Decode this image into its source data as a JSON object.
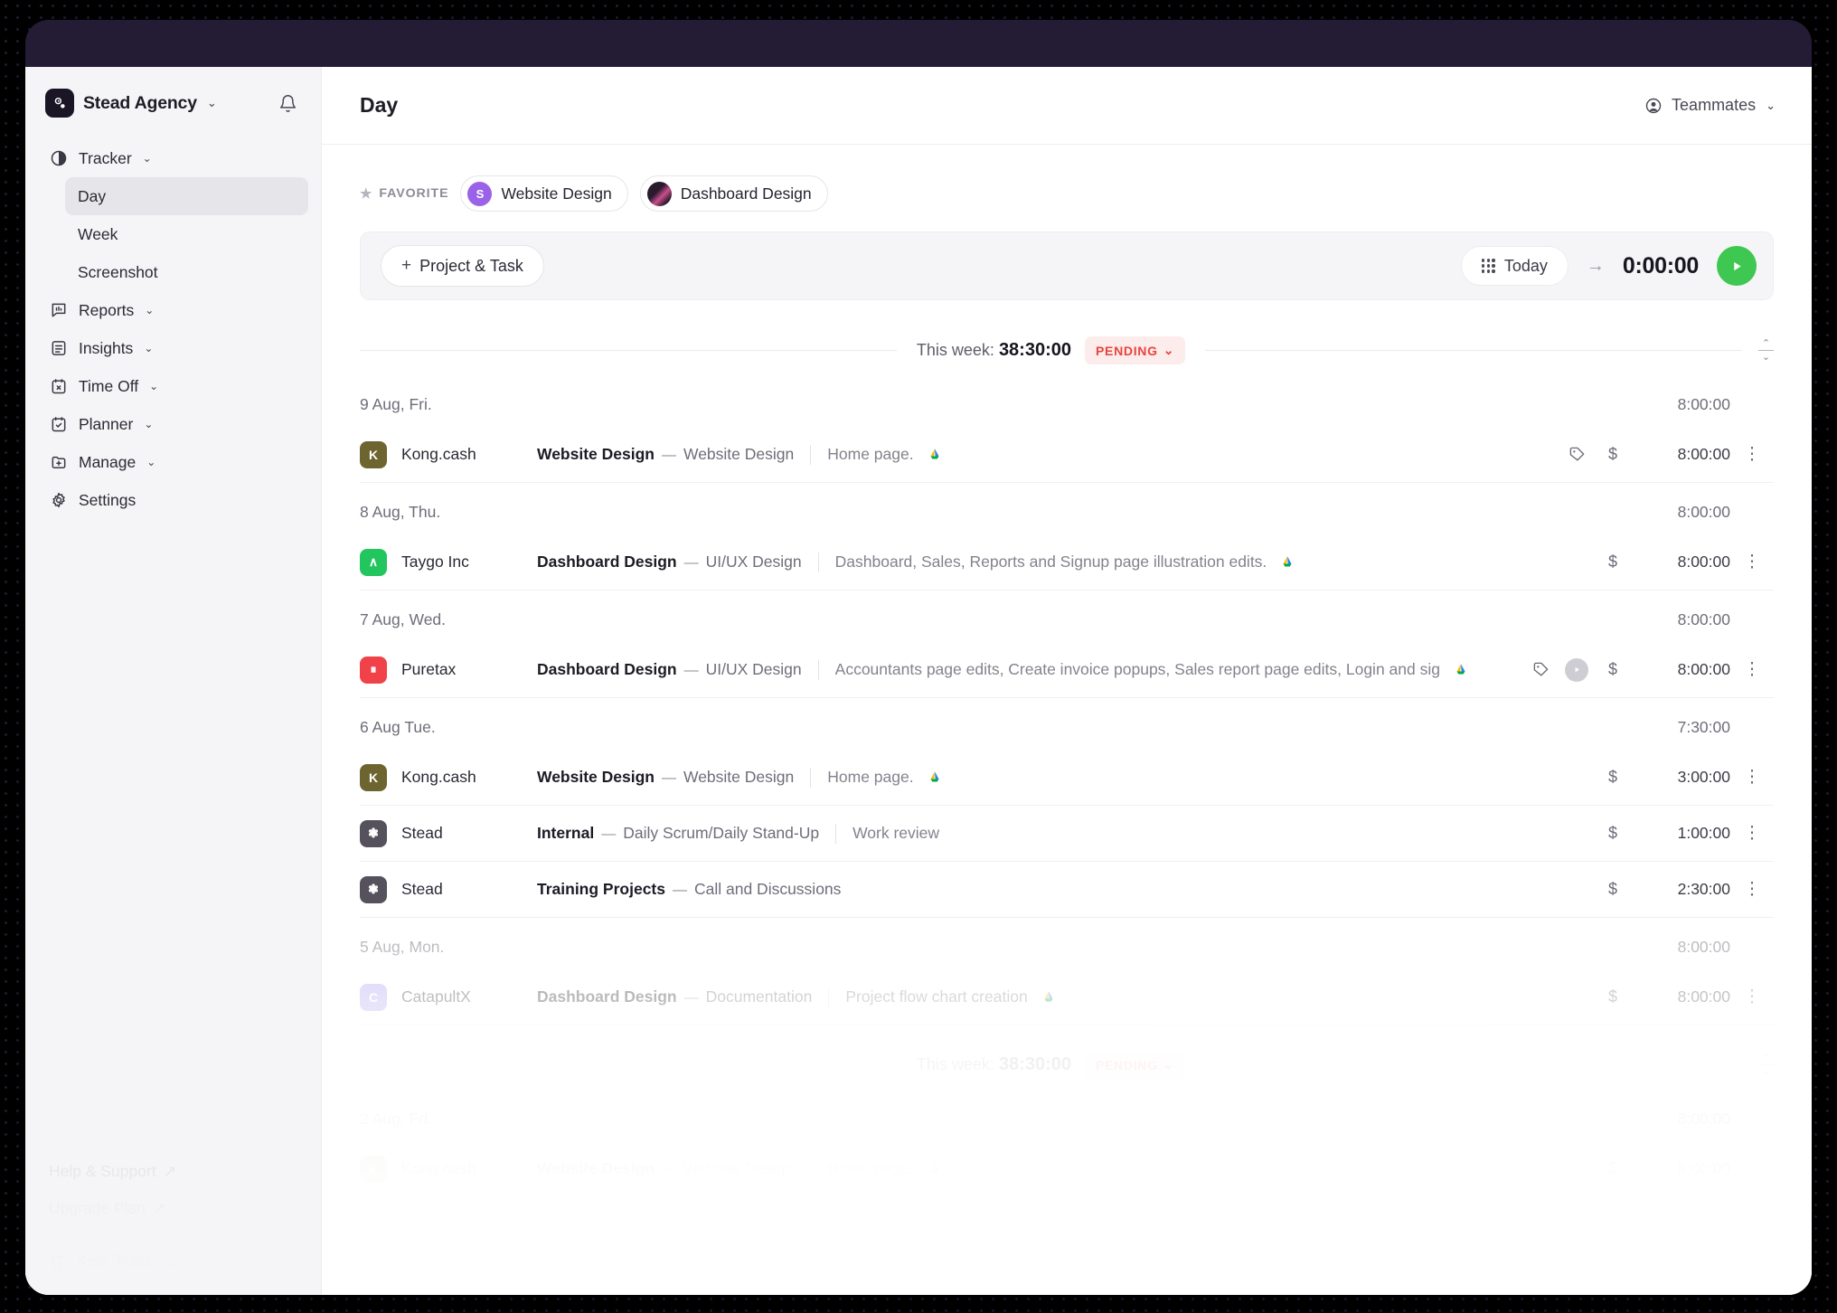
{
  "window": {
    "title_bar_color": "#241c35"
  },
  "sidebar": {
    "brand": {
      "name": "Stead Agency",
      "caret": "⌄",
      "logo_glyph": "❃"
    },
    "bell_icon": "bell-icon",
    "nav": [
      {
        "id": "tracker",
        "label": "Tracker",
        "icon": "clock-icon",
        "caret": "⌄",
        "children": [
          {
            "id": "day",
            "label": "Day",
            "active": true
          },
          {
            "id": "week",
            "label": "Week",
            "active": false
          },
          {
            "id": "screenshot",
            "label": "Screenshot",
            "active": false
          }
        ]
      },
      {
        "id": "reports",
        "label": "Reports",
        "icon": "chart-icon",
        "caret": "⌄"
      },
      {
        "id": "insights",
        "label": "Insights",
        "icon": "list-icon",
        "caret": "⌄"
      },
      {
        "id": "timeoff",
        "label": "Time Off",
        "icon": "calendar-x-icon",
        "caret": "⌄"
      },
      {
        "id": "planner",
        "label": "Planner",
        "icon": "calendar-check-icon",
        "caret": "⌄"
      },
      {
        "id": "manage",
        "label": "Manage",
        "icon": "folder-plus-icon",
        "caret": "⌄"
      },
      {
        "id": "settings",
        "label": "Settings",
        "icon": "gear-icon",
        "caret": ""
      }
    ],
    "footer": {
      "help": "Help & Support",
      "help_arrow": "↗",
      "upgrade": "Upgrade Plan",
      "upgrade_arrow": "↗",
      "product": "Kipe Track",
      "product_caret": "⌄"
    }
  },
  "header": {
    "page_title": "Day",
    "teammates_label": "Teammates",
    "teammates_caret": "⌄",
    "teammates_icon": "user-circle-icon"
  },
  "favorites": {
    "label": "FAVORITE",
    "star": "★",
    "chips": [
      {
        "label": "Website Design",
        "initial": "S",
        "color": "#9a62e8"
      },
      {
        "label": "Dashboard Design",
        "initial": "",
        "color": "#1b1320"
      }
    ]
  },
  "timer": {
    "add_label": "Project & Task",
    "add_plus": "+",
    "today_label": "Today",
    "arrow": "→",
    "elapsed": "0:00:00",
    "play_icon": "play-icon"
  },
  "week_summary": {
    "label": "This week:",
    "total": "38:30:00",
    "status": "PENDING",
    "status_caret": "⌄",
    "status_color": "#e8443d",
    "sort_icon": "sort-icon"
  },
  "groups": [
    {
      "date": "9 Aug, Fri.",
      "total": "8:00:00",
      "opacity": "full",
      "entries": [
        {
          "avatar_initial": "K",
          "avatar_color": "#6e6430",
          "client": "Kong.cash",
          "project": "Website Design",
          "dash": "—",
          "task": "Website Design",
          "description": "Home page.",
          "drive": true,
          "tag_icon": true,
          "grey_play": false,
          "dollar": "$",
          "time": "8:00:00",
          "kebab": "⋮"
        }
      ]
    },
    {
      "date": "8 Aug, Thu.",
      "total": "8:00:00",
      "opacity": "full",
      "entries": [
        {
          "avatar_initial": "∧",
          "avatar_color": "#22c55e",
          "client": "Taygo Inc",
          "project": "Dashboard Design",
          "dash": "—",
          "task": "UI/UX Design",
          "description": "Dashboard, Sales, Reports and Signup page illustration edits.",
          "drive": true,
          "tag_icon": false,
          "grey_play": false,
          "dollar": "$",
          "time": "8:00:00",
          "kebab": "⋮"
        }
      ]
    },
    {
      "date": "7 Aug, Wed.",
      "total": "8:00:00",
      "opacity": "full",
      "entries": [
        {
          "avatar_initial": "⏸",
          "avatar_color": "#f04248",
          "client": "Puretax",
          "project": "Dashboard Design",
          "dash": "—",
          "task": "UI/UX Design",
          "description": "Accountants page edits, Create invoice popups, Sales report page edits, Login and sig",
          "drive": true,
          "tag_icon": true,
          "grey_play": true,
          "dollar": "$",
          "time": "8:00:00",
          "kebab": "⋮"
        }
      ]
    },
    {
      "date": "6 Aug Tue.",
      "total": "7:30:00",
      "opacity": "full",
      "entries": [
        {
          "avatar_initial": "K",
          "avatar_color": "#6e6430",
          "client": "Kong.cash",
          "project": "Website Design",
          "dash": "—",
          "task": "Website Design",
          "description": "Home page.",
          "drive": true,
          "tag_icon": false,
          "grey_play": false,
          "dollar": "$",
          "time": "3:00:00",
          "kebab": "⋮"
        },
        {
          "avatar_initial": "❃",
          "avatar_color": "#55525e",
          "client": "Stead",
          "project": "Internal",
          "dash": "—",
          "task": "Daily Scrum/Daily Stand-Up",
          "description": "Work review",
          "drive": false,
          "tag_icon": false,
          "grey_play": false,
          "dollar": "$",
          "time": "1:00:00",
          "kebab": "⋮"
        },
        {
          "avatar_initial": "❃",
          "avatar_color": "#55525e",
          "client": "Stead",
          "project": "Training Projects",
          "dash": "—",
          "task": "Call and Discussions",
          "description": "",
          "drive": false,
          "tag_icon": false,
          "grey_play": false,
          "dollar": "$",
          "time": "2:30:00",
          "kebab": "⋮"
        }
      ]
    },
    {
      "date": "5 Aug, Mon.",
      "total": "8:00:00",
      "opacity": "dim1",
      "entries": [
        {
          "avatar_initial": "C",
          "avatar_color": "#a89ef0",
          "client": "CatapultX",
          "project": "Dashboard Design",
          "dash": "—",
          "task": "Documentation",
          "description": "Project flow chart creation",
          "drive": true,
          "tag_icon": false,
          "grey_play": false,
          "dollar": "$",
          "time": "8:00:00",
          "kebab": "⋮"
        }
      ]
    }
  ],
  "week_summary_bottom": {
    "label": "This week:",
    "total": "38:30:00",
    "status": "PENDING",
    "status_caret": "⌄"
  },
  "groups_bottom": [
    {
      "date": "2 Aug, Fri.",
      "total": "8:00:00",
      "entries": [
        {
          "avatar_initial": "K",
          "avatar_color": "#6e6430",
          "client": "Kong.cash",
          "project": "Website Design",
          "dash": "—",
          "task": "Website Design",
          "description": "Home page.",
          "drive": true,
          "dollar": "$",
          "time": "8:00:00",
          "kebab": "⋮"
        }
      ]
    }
  ]
}
